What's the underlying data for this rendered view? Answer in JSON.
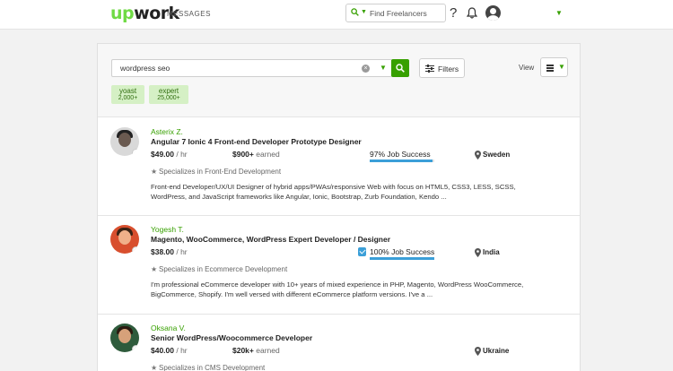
{
  "nav": {
    "logo_accent": "up",
    "logo_rest": "work",
    "messages": "MESSAGES",
    "search_placeholder": "Find Freelancers",
    "help": "?"
  },
  "search": {
    "query": "wordpress seo",
    "filters_label": "Filters",
    "view_label": "View"
  },
  "chips": [
    {
      "label": "yoast",
      "count": "2,000+"
    },
    {
      "label": "expert",
      "count": "25,000+"
    }
  ],
  "freelancers": [
    {
      "name": "Asterix Z.",
      "title": "Angular 7 Ionic 4 Front-end Developer Prototype Designer",
      "rate": "$49.00",
      "rate_unit": " / hr",
      "earned": "$900+",
      "earned_unit": " earned",
      "job_success": "97% Job Success",
      "job_success_pct": 97,
      "top_rated": false,
      "country": "Sweden",
      "specializes": "Specializes in Front-End Development",
      "description": "Front-end Developer/UX/UI Designer of hybrid apps/PWAs/responsive Web with focus on HTML5, CSS3, LESS, SCSS, WordPress, and JavaScript frameworks like Angular, Ionic, Bootstrap, Zurb Foundation, Kendo ..."
    },
    {
      "name": "Yogesh T.",
      "title": "Magento, WooCommerce, WordPress Expert Developer / Designer",
      "rate": "$38.00",
      "rate_unit": " / hr",
      "earned": "",
      "earned_unit": "",
      "job_success": "100% Job Success",
      "job_success_pct": 100,
      "top_rated": true,
      "country": "India",
      "specializes": "Specializes in Ecommerce Development",
      "description": "I'm professional eCommerce developer with 10+ years of mixed experience in PHP, Magento, WordPress WooCommerce, BigCommerce, Shopify. I'm well versed with different eCommerce platform versions. I've a ..."
    },
    {
      "name": "Oksana V.",
      "title": "Senior WordPress/Woocommerce Developer",
      "rate": "$40.00",
      "rate_unit": " / hr",
      "earned": "$20k+",
      "earned_unit": " earned",
      "job_success": "",
      "job_success_pct": null,
      "top_rated": false,
      "country": "Ukraine",
      "specializes": "Specializes in CMS Development",
      "description": ""
    }
  ],
  "colors": {
    "brand_green": "#37a000",
    "logo_green": "#6fda44",
    "job_success_blue": "#3b9fd8",
    "chip_bg": "#d5f0c5"
  },
  "icons": {
    "nav_search": "search-icon",
    "bell": "bell-icon",
    "avatar": "user-avatar-icon",
    "filters": "sliders-icon",
    "view": "list-view-icon",
    "location": "map-pin-icon",
    "specialty": "star-icon",
    "top_rated": "badge-check-icon"
  }
}
